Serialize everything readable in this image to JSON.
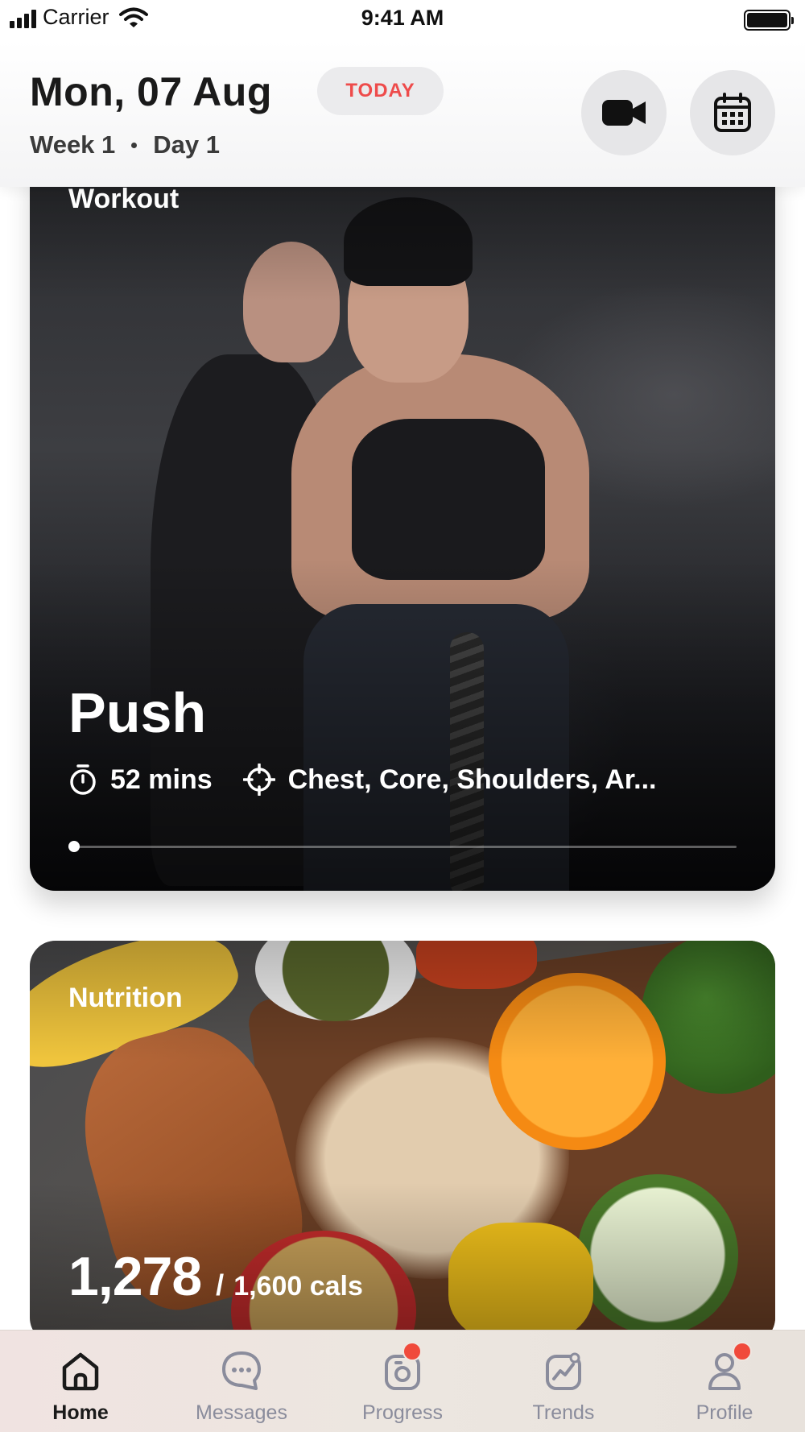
{
  "status_bar": {
    "carrier": "Carrier",
    "time": "9:41 AM"
  },
  "header": {
    "date": "Mon, 07 Aug",
    "today_badge": "TODAY",
    "week": "Week 1",
    "day": "Day 1",
    "buttons": [
      {
        "icon": "video-camera-icon"
      },
      {
        "icon": "calendar-icon"
      }
    ]
  },
  "workout_card": {
    "label": "Workout",
    "name": "Push",
    "duration": "52 mins",
    "muscles": "Chest, Core, Shoulders, Ar...",
    "progress": 0.0,
    "icons": {
      "duration": "stopwatch-icon",
      "muscles": "crosshair-icon"
    }
  },
  "nutrition_card": {
    "label": "Nutrition",
    "calories_consumed": "1,278",
    "separator": "/",
    "calories_target": "1,600 cals"
  },
  "tab_bar": {
    "tabs": [
      {
        "label": "Home",
        "icon": "home-icon",
        "active": true,
        "badge": false
      },
      {
        "label": "Messages",
        "icon": "chat-bubble-icon",
        "active": false,
        "badge": false
      },
      {
        "label": "Progress",
        "icon": "camera-icon",
        "active": false,
        "badge": true
      },
      {
        "label": "Trends",
        "icon": "trend-chart-icon",
        "active": false,
        "badge": false
      },
      {
        "label": "Profile",
        "icon": "user-icon",
        "active": false,
        "badge": true
      }
    ]
  },
  "colors": {
    "accent_red": "#ee4b4b",
    "badge_red": "#f04a3b",
    "inactive_tab": "#8a8c9c",
    "text_dark": "#1a1a1a"
  }
}
